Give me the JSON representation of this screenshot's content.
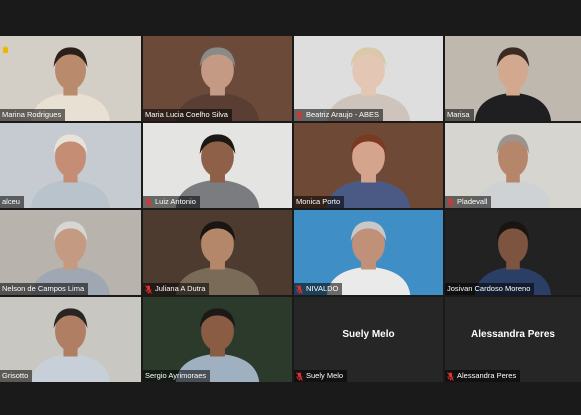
{
  "participants": [
    {
      "name": "Marina Rodrigues",
      "muted": false,
      "bg": "#d4cfc6",
      "skin": "#b98a6c",
      "hair": "#2a1f1a",
      "shirt": "#e8e0d2",
      "raised_hand": true
    },
    {
      "name": "Maria Lucia Coelho Silva",
      "muted": false,
      "bg": "#6b4a3a",
      "skin": "#c49a84",
      "hair": "#8a8a86",
      "shirt": "#5a3e33"
    },
    {
      "name": "Beatriz Araujo - ABES",
      "muted": true,
      "bg": "#dedede",
      "skin": "#e4c6b5",
      "hair": "#d9c9a8",
      "shirt": "#cfc4bb"
    },
    {
      "name": "Marisa",
      "muted": false,
      "bg": "#bfb8ae",
      "skin": "#d2a98f",
      "hair": "#3b2a22",
      "shirt": "#1f1f22"
    },
    {
      "name": "alceu",
      "muted": false,
      "bg": "#c5cbd0",
      "skin": "#c58e74",
      "hair": "#e9e2da",
      "shirt": "#b9c3cc"
    },
    {
      "name": "Luiz Antonio",
      "muted": true,
      "bg": "#e4e4e2",
      "skin": "#8e6048",
      "hair": "#1d1714",
      "shirt": "#7a7c80"
    },
    {
      "name": "Monica Porto",
      "muted": false,
      "bg": "#6e4a36",
      "skin": "#d4a48c",
      "hair": "#7a3a22",
      "shirt": "#4a5a84"
    },
    {
      "name": "Pladevall",
      "muted": true,
      "bg": "#d7d5cf",
      "skin": "#b5866a",
      "hair": "#9a948e",
      "shirt": "#cfd2d5"
    },
    {
      "name": "Nelson de Campos Lima",
      "muted": false,
      "bg": "#b8b4ad",
      "skin": "#c59a82",
      "hair": "#d8d6d2",
      "shirt": "#9ea7b2"
    },
    {
      "name": "Juliana A Dutra",
      "muted": true,
      "bg": "#4d3b30",
      "skin": "#b5876a",
      "hair": "#1a1412",
      "shirt": "#7a6a58"
    },
    {
      "name": "NIVALDO",
      "muted": true,
      "bg": "#3f8fc6",
      "skin": "#c09078",
      "hair": "#c8c8c8",
      "shirt": "#eaeaea"
    },
    {
      "name": "Josivan Cardoso Moreno",
      "muted": false,
      "bg": "#222222",
      "skin": "#7c5440",
      "hair": "#1a1411",
      "shirt": "#2b3e66"
    },
    {
      "name": "Grisotto",
      "muted": false,
      "bg": "#c9c7c2",
      "skin": "#b07e63",
      "hair": "#2a2523",
      "shirt": "#c7d0d9"
    },
    {
      "name": "Sergio Ayrimoraes",
      "muted": false,
      "bg": "#2c3a2c",
      "skin": "#8a5c44",
      "hair": "#1c1816",
      "shirt": "#9fb0c0",
      "active": true
    },
    {
      "name": "Suely Melo",
      "muted": true,
      "video_off": true
    },
    {
      "name": "Alessandra Peres",
      "muted": true,
      "video_off": true
    }
  ],
  "colors": {
    "active_border": "#c9d64a",
    "muted_icon": "#e0312f",
    "background": "#1a1a1a"
  }
}
